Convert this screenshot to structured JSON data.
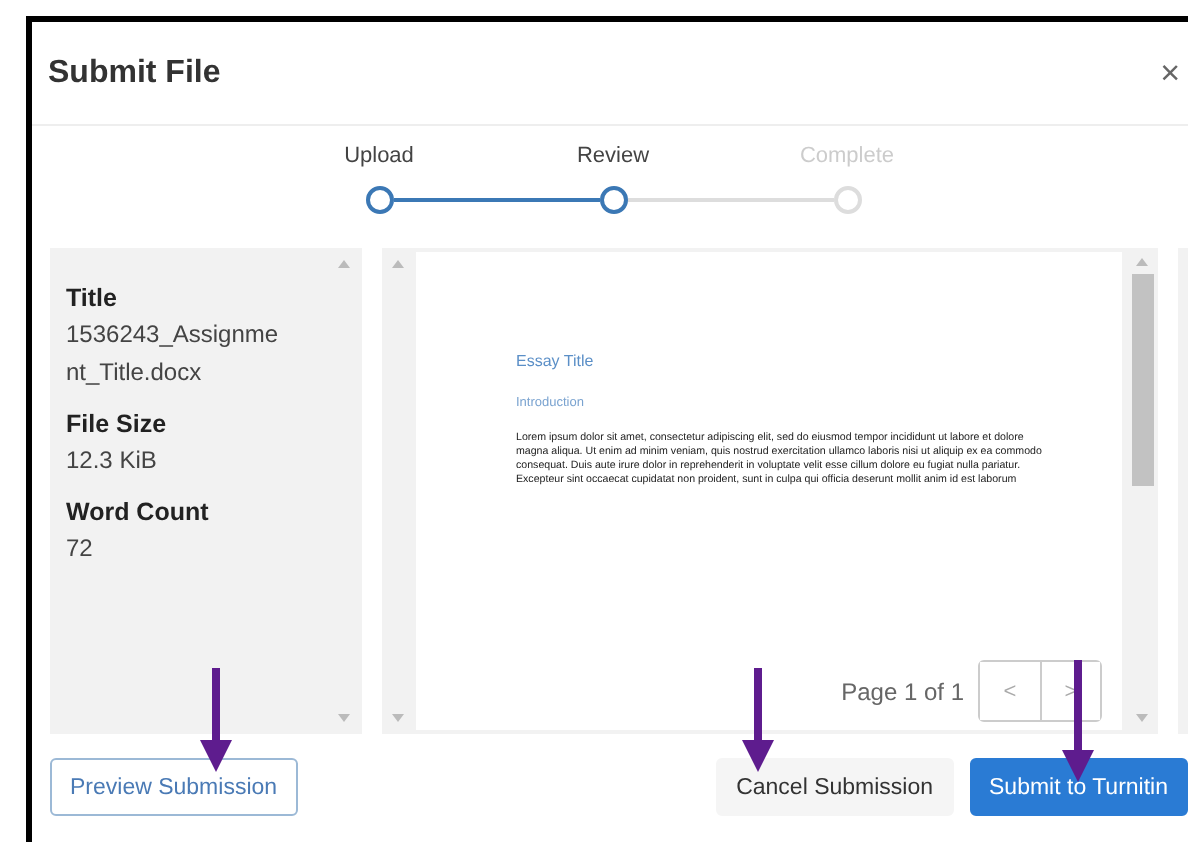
{
  "dialog": {
    "title": "Submit File",
    "close": "×"
  },
  "steps": [
    {
      "label": "Upload",
      "reached": true
    },
    {
      "label": "Review",
      "reached": true
    },
    {
      "label": "Complete",
      "reached": false
    }
  ],
  "details": [
    {
      "label": "Title",
      "value": "1536243_Assignment_Title.docx"
    },
    {
      "label": "File Size",
      "value": "12.3 KiB"
    },
    {
      "label": "Word Count",
      "value": "72"
    }
  ],
  "preview": {
    "heading": "Essay Title",
    "subheading": "Introduction",
    "body": "Lorem ipsum dolor sit amet, consectetur adipiscing elit, sed do eiusmod tempor incididunt ut labore et dolore magna aliqua. Ut enim ad minim veniam, quis nostrud exercitation ullamco laboris nisi ut aliquip ex ea commodo consequat. Duis aute irure dolor in reprehenderit in voluptate velit esse cillum dolore eu fugiat nulla pariatur. Excepteur sint occaecat cupidatat non proident, sunt in culpa qui officia deserunt mollit anim id est laborum",
    "page_info": "Page 1 of 1",
    "prev": "<",
    "next": ">"
  },
  "buttons": [
    {
      "label": "Preview Submission",
      "kind": "outline"
    },
    {
      "label": "Cancel Submission",
      "kind": "secondary"
    },
    {
      "label": "Submit to Turnitin",
      "kind": "primary"
    }
  ]
}
